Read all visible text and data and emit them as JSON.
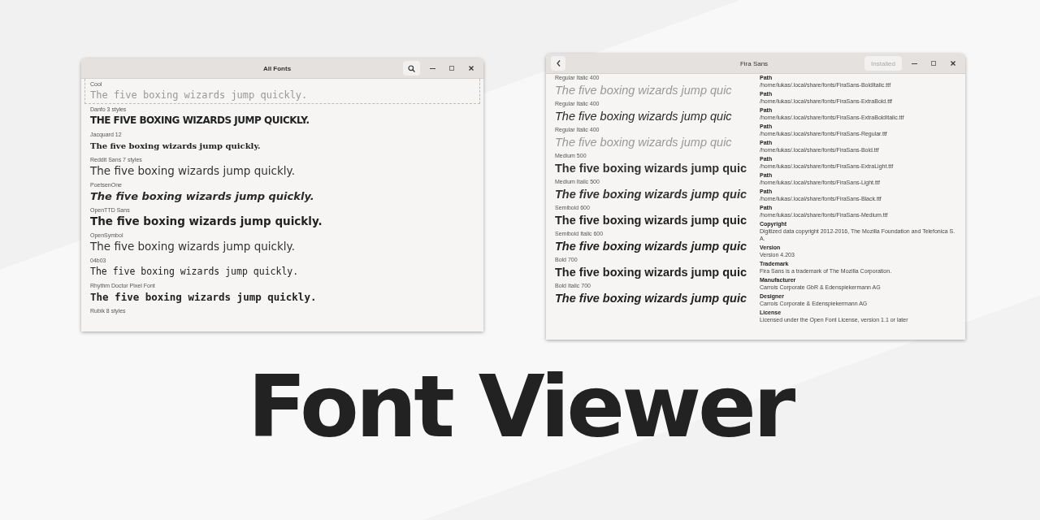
{
  "all_fonts_window": {
    "title": "All Fonts",
    "fonts": [
      {
        "name": "Cool",
        "sample": "The five boxing wizards jump quickly.",
        "kind": "light",
        "selected": true
      },
      {
        "name": "Danfo 3 styles",
        "sample": "THE FIVE BOXING WIZARDS JUMP QUICKLY.",
        "kind": "display",
        "selected": false
      },
      {
        "name": "Jacquard 12",
        "sample": "The five boxing wizards jump quickly.",
        "kind": "serif",
        "selected": false
      },
      {
        "name": "Reddit Sans 7 styles",
        "sample": "The five boxing wizards jump quickly.",
        "kind": "regular",
        "selected": false
      },
      {
        "name": "PoetsenOne",
        "sample": "The five boxing wizards jump quickly.",
        "kind": "bolditalic",
        "selected": false
      },
      {
        "name": "OpenTTD Sans",
        "sample": "The five boxing wizards jump quickly.",
        "kind": "bold",
        "selected": false
      },
      {
        "name": "OpenSymbol",
        "sample": "The five boxing wizards jump quickly.",
        "kind": "regular",
        "selected": false
      },
      {
        "name": "04b03",
        "sample": "The five boxing wizards jump quickly.",
        "kind": "mono",
        "selected": false
      },
      {
        "name": "Rhythm Doctor Pixel Font",
        "sample": "The five boxing wizards jump quickly.",
        "kind": "monobold",
        "selected": false
      },
      {
        "name": "Rubik 8 styles",
        "selected": false
      }
    ]
  },
  "font_window": {
    "title": "Fira Sans",
    "installed_button": "Installed",
    "styles": [
      {
        "label": "Regular Italic 400",
        "sample": "The five boxing wizards jump quic",
        "kind": "light",
        "italic": true
      },
      {
        "label": "Regular Italic 400",
        "sample": "The five boxing wizards jump quic",
        "kind": "regular",
        "italic": true
      },
      {
        "label": "Regular Italic 400",
        "sample": "The five boxing wizards jump quic",
        "kind": "light",
        "italic": true
      },
      {
        "label": "Medium 500",
        "sample": "The five boxing wizards jump quic",
        "kind": "medium",
        "italic": false
      },
      {
        "label": "Medium Italic 500",
        "sample": "The five boxing wizards jump quic",
        "kind": "medium",
        "italic": true
      },
      {
        "label": "Semibold 600",
        "sample": "The five boxing wizards jump quic",
        "kind": "bold",
        "italic": false
      },
      {
        "label": "Semibold Italic 600",
        "sample": "The five boxing wizards jump quic",
        "kind": "bold",
        "italic": true
      },
      {
        "label": "Bold 700",
        "sample": "The five boxing wizards jump quic",
        "kind": "bold",
        "italic": false
      },
      {
        "label": "Bold Italic 700",
        "sample": "The five boxing wizards jump quic",
        "kind": "bold",
        "italic": true
      }
    ],
    "details": [
      {
        "label": "Path",
        "value": "/home/lukas/.local/share/fonts/FiraSans-BoldItalic.ttf"
      },
      {
        "label": "Path",
        "value": "/home/lukas/.local/share/fonts/FiraSans-ExtraBold.ttf"
      },
      {
        "label": "Path",
        "value": "/home/lukas/.local/share/fonts/FiraSans-ExtraBoldItalic.ttf"
      },
      {
        "label": "Path",
        "value": "/home/lukas/.local/share/fonts/FiraSans-Regular.ttf"
      },
      {
        "label": "Path",
        "value": "/home/lukas/.local/share/fonts/FiraSans-Bold.ttf"
      },
      {
        "label": "Path",
        "value": "/home/lukas/.local/share/fonts/FiraSans-ExtraLight.ttf"
      },
      {
        "label": "Path",
        "value": "/home/lukas/.local/share/fonts/FiraSans-Light.ttf"
      },
      {
        "label": "Path",
        "value": "/home/lukas/.local/share/fonts/FiraSans-Black.ttf"
      },
      {
        "label": "Path",
        "value": "/home/lukas/.local/share/fonts/FiraSans-Medium.ttf"
      },
      {
        "label": "Copyright",
        "value": "Digitized data copyright 2012-2016, The Mozilla Foundation and Telefonica S.A."
      },
      {
        "label": "Version",
        "value": "Version 4.203"
      },
      {
        "label": "Trademark",
        "value": "Fira Sans is a trademark of The Mozilla Corporation."
      },
      {
        "label": "Manufacturer",
        "value": "Carrois Corporate GbR & Edenspiekermann AG"
      },
      {
        "label": "Designer",
        "value": "Carrois Corporate & Edenspiekermann AG"
      },
      {
        "label": "License",
        "value": "Licensed under the Open Font License, version 1.1 or later"
      }
    ]
  },
  "headline": "Font Viewer"
}
